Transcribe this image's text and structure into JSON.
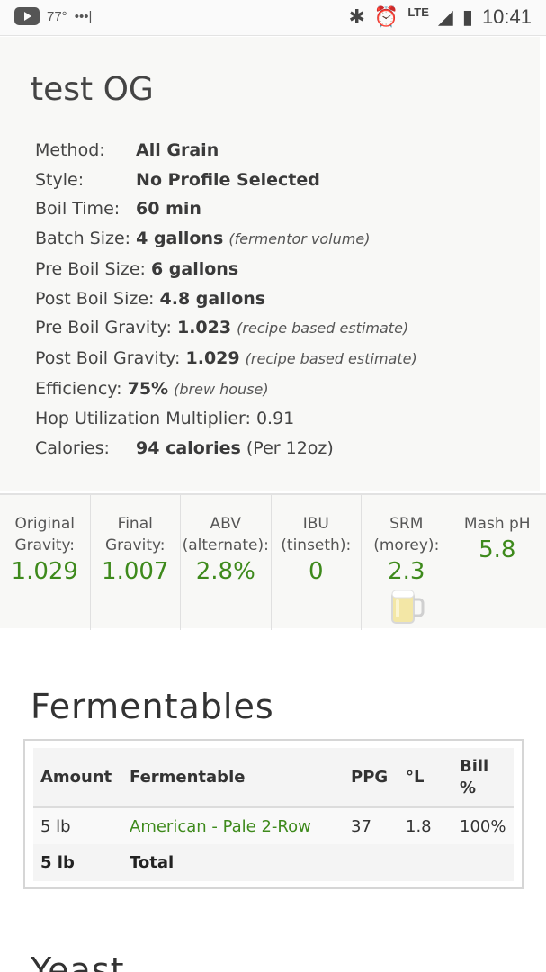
{
  "status_bar": {
    "temperature": "77°",
    "dots": "•••|",
    "network": "LTE",
    "time": "10:41",
    "icons": [
      "youtube-icon",
      "bluetooth-icon",
      "alarm-icon",
      "signal-icon",
      "battery-icon"
    ]
  },
  "recipe": {
    "title": "test OG",
    "method_label": "Method:",
    "method_value": "All Grain",
    "style_label": "Style:",
    "style_value": "No Profile Selected",
    "boil_time_label": "Boil Time:",
    "boil_time_value": "60 min",
    "batch_size_label": "Batch Size:",
    "batch_size_value": "4 gallons",
    "batch_size_note": "(fermentor volume)",
    "pre_boil_size_label": "Pre Boil Size:",
    "pre_boil_size_value": "6 gallons",
    "post_boil_size_label": "Post Boil Size:",
    "post_boil_size_value": "4.8 gallons",
    "pre_boil_gravity_label": "Pre Boil Gravity:",
    "pre_boil_gravity_value": "1.023",
    "pre_boil_gravity_note": "(recipe based estimate)",
    "post_boil_gravity_label": "Post Boil Gravity:",
    "post_boil_gravity_value": "1.029",
    "post_boil_gravity_note": "(recipe based estimate)",
    "efficiency_label": "Efficiency:",
    "efficiency_value": "75%",
    "efficiency_note": "(brew house)",
    "hop_util_label": "Hop Utilization Multiplier:",
    "hop_util_value": "0.91",
    "calories_label": "Calories:",
    "calories_value": "94 calories",
    "calories_note": "(Per 12oz)"
  },
  "stats": [
    {
      "label1": "Original",
      "label2": "Gravity:",
      "value": "1.029"
    },
    {
      "label1": "Final",
      "label2": "Gravity:",
      "value": "1.007"
    },
    {
      "label1": "ABV",
      "label2": "(alternate):",
      "value": "2.8%"
    },
    {
      "label1": "IBU",
      "label2": "(tinseth):",
      "value": "0"
    },
    {
      "label1": "SRM",
      "label2": "(morey):",
      "value": "2.3"
    },
    {
      "label1": "Mash pH",
      "label2": "",
      "value": "5.8"
    }
  ],
  "fermentables": {
    "heading": "Fermentables",
    "columns": [
      "Amount",
      "Fermentable",
      "PPG",
      "°L",
      "Bill",
      "%"
    ],
    "rows": [
      {
        "amount": "5 lb",
        "name": "American - Pale 2-Row",
        "ppg": "37",
        "lovibond": "1.8",
        "bill": "100%"
      }
    ],
    "total_amount": "5 lb",
    "total_label": "Total"
  },
  "next_heading": "Yeast",
  "colors": {
    "accent_green": "#3e8a1c",
    "card_bg": "#f8f8f6"
  }
}
